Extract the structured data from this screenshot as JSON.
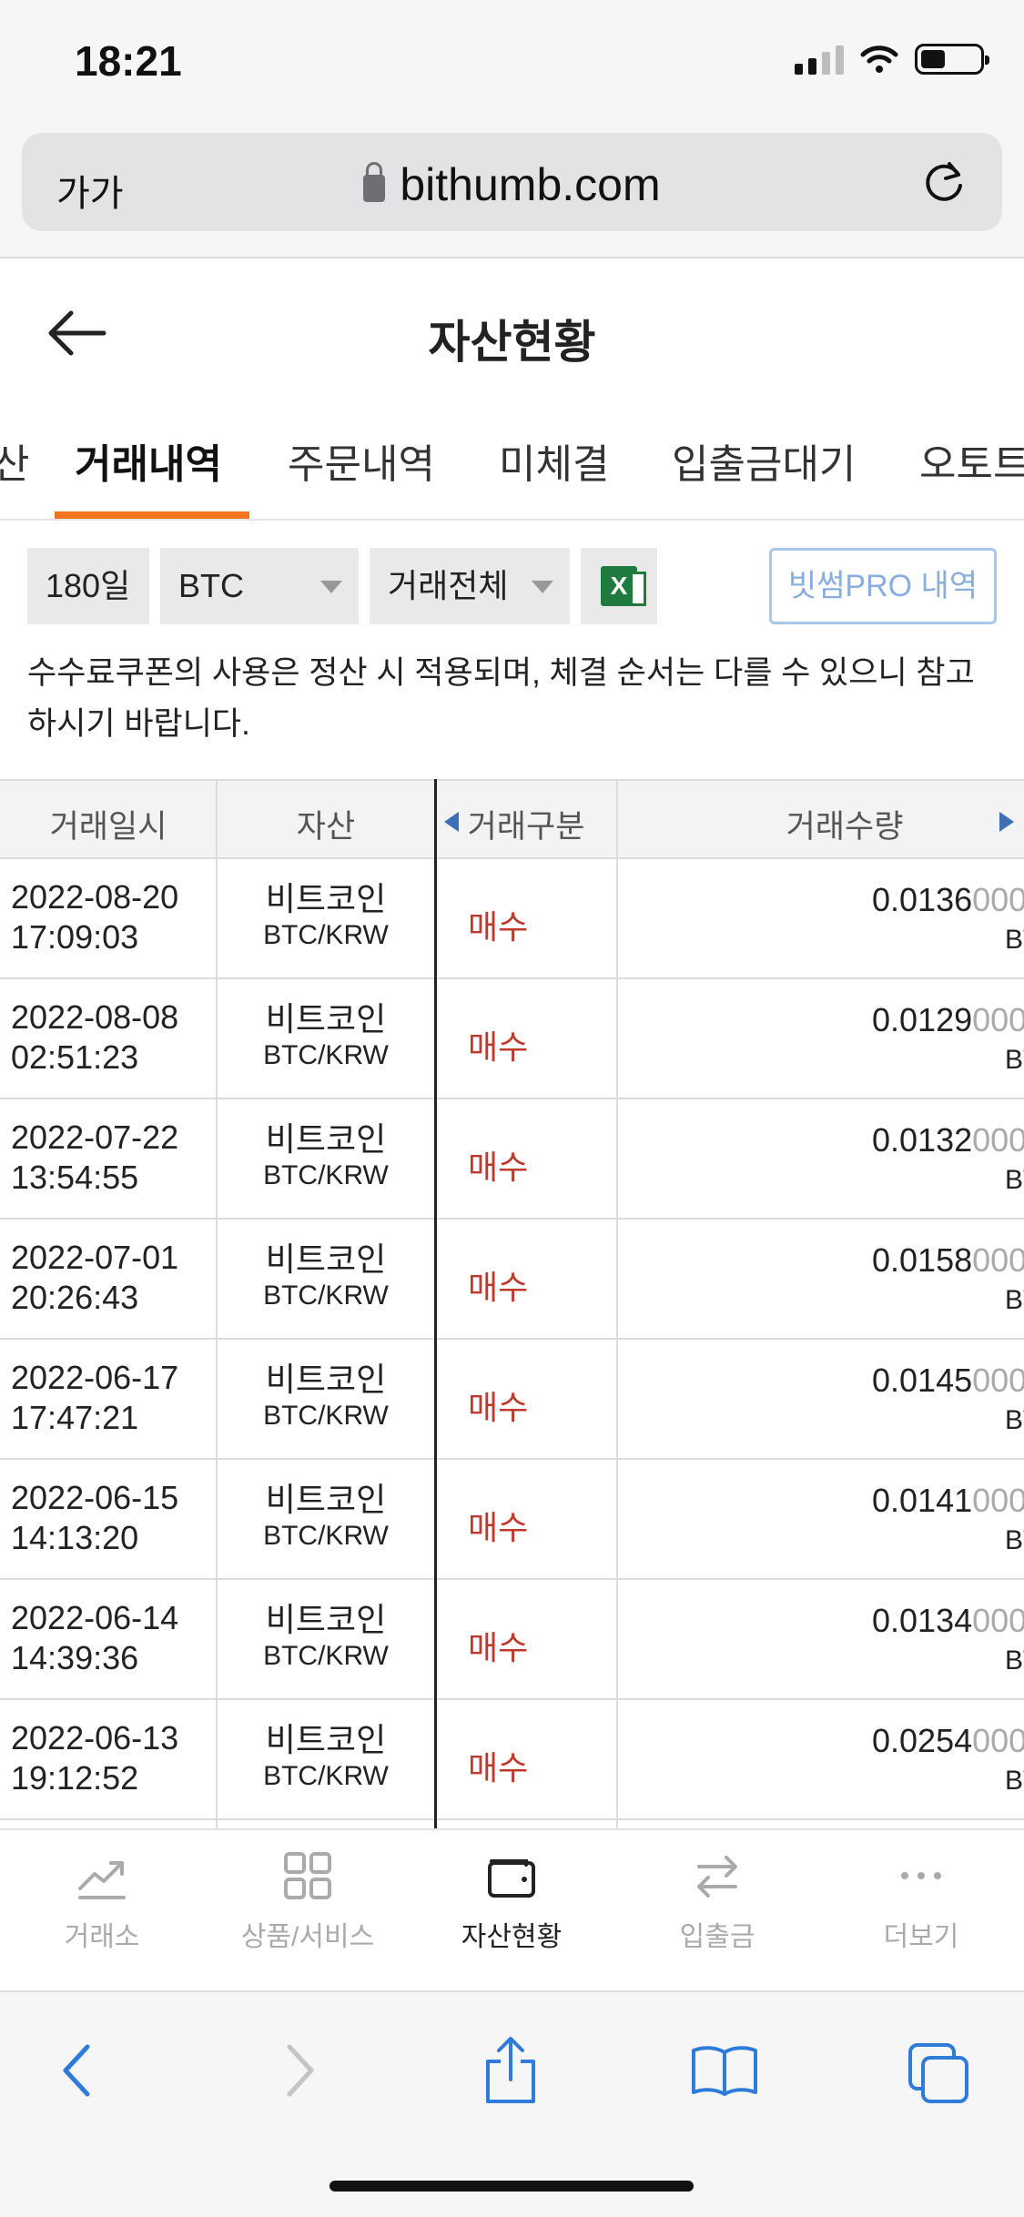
{
  "status_bar": {
    "time": "18:21"
  },
  "browser": {
    "text_size": "가가",
    "url": "bithumb.com"
  },
  "header": {
    "title": "자산현황"
  },
  "tabs": [
    {
      "label": "산"
    },
    {
      "label": "거래내역",
      "active": true
    },
    {
      "label": "주문내역"
    },
    {
      "label": "미체결"
    },
    {
      "label": "입출금대기"
    },
    {
      "label": "오토트"
    }
  ],
  "filters": {
    "period": "180일",
    "coin": "BTC",
    "trade_type": "거래전체",
    "excel_icon": "excel-icon",
    "pro_button": "빗썸PRO 내역"
  },
  "notice": "수수료쿠폰의 사용은 정산 시 적용되며, 체결 순서는 다를 수 있으니 참고하시기 바랍니다.",
  "table": {
    "headers": [
      "거래일시",
      "자산",
      "거래구분",
      "거래수량"
    ],
    "rows": [
      {
        "date": "2022-08-20",
        "time": "17:09:03",
        "asset": "비트코인",
        "pair": "BTC/KRW",
        "type": "매수",
        "qty": "0.0136",
        "qty_zeros": "000",
        "unit": "BT"
      },
      {
        "date": "2022-08-08",
        "time": "02:51:23",
        "asset": "비트코인",
        "pair": "BTC/KRW",
        "type": "매수",
        "qty": "0.0129",
        "qty_zeros": "000",
        "unit": "BT"
      },
      {
        "date": "2022-07-22",
        "time": "13:54:55",
        "asset": "비트코인",
        "pair": "BTC/KRW",
        "type": "매수",
        "qty": "0.0132",
        "qty_zeros": "000",
        "unit": "BT"
      },
      {
        "date": "2022-07-01",
        "time": "20:26:43",
        "asset": "비트코인",
        "pair": "BTC/KRW",
        "type": "매수",
        "qty": "0.0158",
        "qty_zeros": "000",
        "unit": "BT"
      },
      {
        "date": "2022-06-17",
        "time": "17:47:21",
        "asset": "비트코인",
        "pair": "BTC/KRW",
        "type": "매수",
        "qty": "0.0145",
        "qty_zeros": "000",
        "unit": "BT"
      },
      {
        "date": "2022-06-15",
        "time": "14:13:20",
        "asset": "비트코인",
        "pair": "BTC/KRW",
        "type": "매수",
        "qty": "0.0141",
        "qty_zeros": "000",
        "unit": "BT"
      },
      {
        "date": "2022-06-14",
        "time": "14:39:36",
        "asset": "비트코인",
        "pair": "BTC/KRW",
        "type": "매수",
        "qty": "0.0134",
        "qty_zeros": "000",
        "unit": "BT"
      },
      {
        "date": "2022-06-13",
        "time": "19:12:52",
        "asset": "비트코인",
        "pair": "BTC/KRW",
        "type": "매수",
        "qty": "0.0254",
        "qty_zeros": "000",
        "unit": "BT"
      }
    ]
  },
  "app_nav": [
    {
      "label": "거래소",
      "icon": "chart-line-icon"
    },
    {
      "label": "상품/서비스",
      "icon": "grid-icon"
    },
    {
      "label": "자산현황",
      "icon": "wallet-icon",
      "active": true
    },
    {
      "label": "입출금",
      "icon": "transfer-icon"
    },
    {
      "label": "더보기",
      "icon": "more-dots-icon"
    }
  ],
  "colors": {
    "accent_orange": "#f37321",
    "buy_red": "#c0392b",
    "pro_blue": "#88aee0",
    "safari_blue": "#2f7bd9"
  }
}
